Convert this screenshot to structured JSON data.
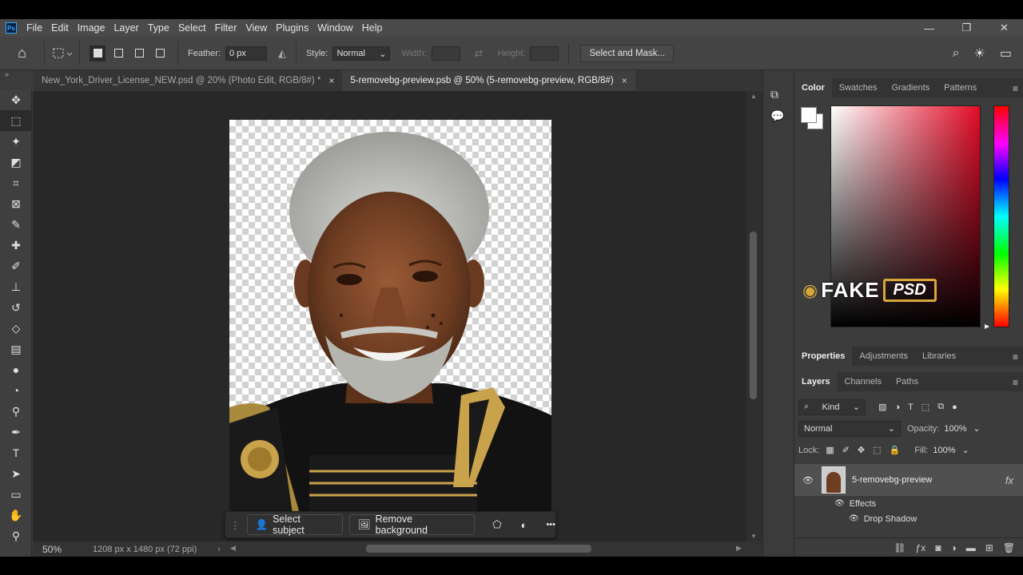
{
  "menubar": {
    "logo": "Ps",
    "items": [
      "File",
      "Edit",
      "Image",
      "Layer",
      "Type",
      "Select",
      "Filter",
      "View",
      "Plugins",
      "Window",
      "Help"
    ],
    "window_controls": [
      "—",
      "❐",
      "✕"
    ]
  },
  "options": {
    "feather_label": "Feather:",
    "feather_value": "0 px",
    "style_label": "Style:",
    "style_value": "Normal",
    "width_label": "Width:",
    "height_label": "Height:",
    "select_mask": "Select and Mask..."
  },
  "tabs": [
    {
      "label": "New_York_Driver_License_NEW.psd @ 20% (Photo Edit, RGB/8#) *",
      "close": "×",
      "active": false
    },
    {
      "label": "5-removebg-preview.psb @ 50% (5-removebg-preview, RGB/8#)",
      "close": "×",
      "active": true
    }
  ],
  "status": {
    "zoom": "50%",
    "doc_info": "1208 px x 1480 px (72 ppi)"
  },
  "contextual_taskbar": {
    "select_subject": "Select subject",
    "remove_background": "Remove background",
    "more": "•••"
  },
  "color_panel": {
    "tabs": [
      "Color",
      "Swatches",
      "Gradients",
      "Patterns"
    ],
    "active_hue": "#e30c27",
    "watermark_left": "FAKE",
    "watermark_right": "PSD"
  },
  "properties_panel": {
    "tabs": [
      "Properties",
      "Adjustments",
      "Libraries"
    ]
  },
  "layers_panel": {
    "tabs": [
      "Layers",
      "Channels",
      "Paths"
    ],
    "kind": "Kind",
    "blend_mode": "Normal",
    "opacity_label": "Opacity:",
    "opacity_value": "100%",
    "lock_label": "Lock:",
    "fill_label": "Fill:",
    "fill_value": "100%",
    "layer_name": "5-removebg-preview",
    "fx": "fx",
    "effects_label": "Effects",
    "drop_shadow_label": "Drop Shadow"
  }
}
